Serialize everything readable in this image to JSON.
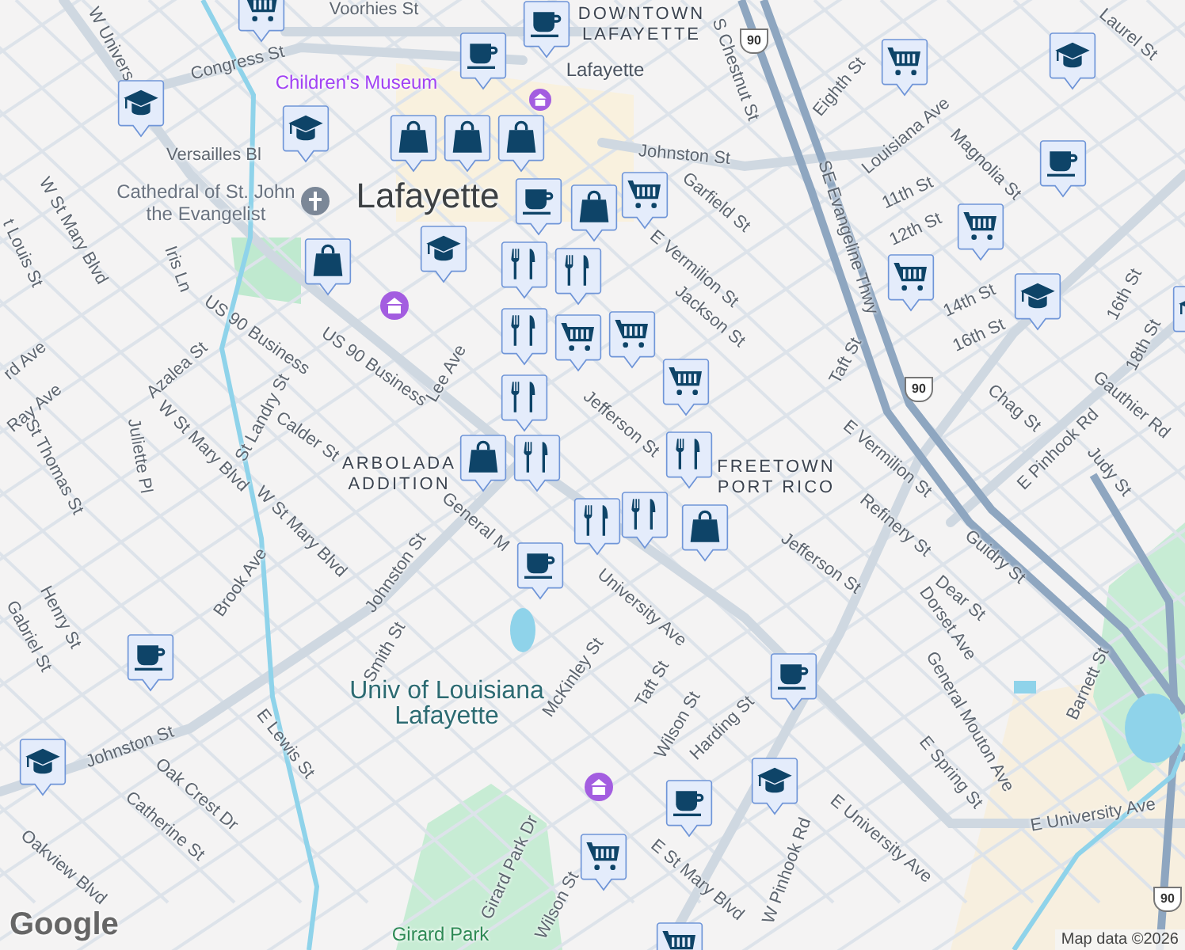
{
  "map": {
    "labels": [
      {
        "text": "Voorhies St",
        "kind": "street"
      },
      {
        "text": "W Univers",
        "kind": "street"
      },
      {
        "text": "Congress St",
        "kind": "street"
      },
      {
        "text": "Versailles Bl",
        "kind": "street"
      },
      {
        "text": "Cathedral of St. John the Evangelist",
        "kind": "poi"
      },
      {
        "text": "W St Mary Blvd",
        "kind": "street"
      },
      {
        "text": "t Louis St",
        "kind": "street"
      },
      {
        "text": "Iris Ln",
        "kind": "street"
      },
      {
        "text": "US 90 Business",
        "kind": "street"
      },
      {
        "text": "US 90 Business",
        "kind": "street"
      },
      {
        "text": "Azalea St",
        "kind": "street"
      },
      {
        "text": "St Landry St",
        "kind": "street"
      },
      {
        "text": "W St Mary Blvd",
        "kind": "street"
      },
      {
        "text": "rd Ave",
        "kind": "street"
      },
      {
        "text": "Ray Ave",
        "kind": "street"
      },
      {
        "text": "St Thomas St",
        "kind": "street"
      },
      {
        "text": "Juliette Pl",
        "kind": "street"
      },
      {
        "text": "Calder St",
        "kind": "street"
      },
      {
        "text": "Lee Ave",
        "kind": "street"
      },
      {
        "text": "Lafayette",
        "kind": "city"
      },
      {
        "text": "General M",
        "kind": "street"
      },
      {
        "text": "Jefferson St",
        "kind": "street"
      },
      {
        "text": "Jackson St",
        "kind": "street"
      },
      {
        "text": "E Vermilion St",
        "kind": "street"
      },
      {
        "text": "Garfield St",
        "kind": "street"
      },
      {
        "text": "Johnston St",
        "kind": "street"
      },
      {
        "text": "ARBOLADA ADDITION",
        "kind": "area"
      },
      {
        "text": "DOWNTOWN LAFAYETTE",
        "kind": "area"
      },
      {
        "text": "Lafayette",
        "kind": "station"
      },
      {
        "text": "Children's Museum",
        "kind": "museum"
      },
      {
        "text": "S Chestnut St",
        "kind": "street"
      },
      {
        "text": "Eighth St",
        "kind": "street"
      },
      {
        "text": "Louisiana Ave",
        "kind": "street"
      },
      {
        "text": "Magnolia St",
        "kind": "street"
      },
      {
        "text": "SE Evangeline Thwy",
        "kind": "street"
      },
      {
        "text": "11th St",
        "kind": "street"
      },
      {
        "text": "12th St",
        "kind": "street"
      },
      {
        "text": "14th St",
        "kind": "street"
      },
      {
        "text": "16th St",
        "kind": "street"
      },
      {
        "text": "16th St",
        "kind": "street"
      },
      {
        "text": "18th St",
        "kind": "street"
      },
      {
        "text": "Laurel St",
        "kind": "street"
      },
      {
        "text": "Taft St",
        "kind": "street"
      },
      {
        "text": "Chag St",
        "kind": "street"
      },
      {
        "text": "E Pinhook Rd",
        "kind": "street"
      },
      {
        "text": "Judy St",
        "kind": "street"
      },
      {
        "text": "Gauthier Rd",
        "kind": "street"
      },
      {
        "text": "E Vermilion St",
        "kind": "street"
      },
      {
        "text": "FREETOWN PORT RICO",
        "kind": "area"
      },
      {
        "text": "Refinery St",
        "kind": "street"
      },
      {
        "text": "Guidry St",
        "kind": "street"
      },
      {
        "text": "Dear St",
        "kind": "street"
      },
      {
        "text": "Jefferson St",
        "kind": "street"
      },
      {
        "text": "Dorset Ave",
        "kind": "street"
      },
      {
        "text": "General Mouton Ave",
        "kind": "street"
      },
      {
        "text": "Barnett St",
        "kind": "street"
      },
      {
        "text": "E Spring St",
        "kind": "street"
      },
      {
        "text": "E University Ave",
        "kind": "street"
      },
      {
        "text": "E University Ave",
        "kind": "street"
      },
      {
        "text": "University Ave",
        "kind": "street"
      },
      {
        "text": "McKinley St",
        "kind": "street"
      },
      {
        "text": "Taft St",
        "kind": "street"
      },
      {
        "text": "Wilson St",
        "kind": "street"
      },
      {
        "text": "Harding St",
        "kind": "street"
      },
      {
        "text": "W Pinhook Rd",
        "kind": "street"
      },
      {
        "text": "E St Mary Blvd",
        "kind": "street"
      },
      {
        "text": "Johnston St",
        "kind": "street"
      },
      {
        "text": "Brook Ave",
        "kind": "street"
      },
      {
        "text": "W St Mary Blvd",
        "kind": "street"
      },
      {
        "text": "Smith St",
        "kind": "street"
      },
      {
        "text": "Univ of Louisiana Lafayette",
        "kind": "campus"
      },
      {
        "text": "E Lewis St",
        "kind": "street"
      },
      {
        "text": "Johnston St",
        "kind": "street"
      },
      {
        "text": "Oak Crest Dr",
        "kind": "street"
      },
      {
        "text": "Catherine St",
        "kind": "street"
      },
      {
        "text": "Oakview Blvd",
        "kind": "street"
      },
      {
        "text": "Henry St",
        "kind": "street"
      },
      {
        "text": "Gabriel St",
        "kind": "street"
      },
      {
        "text": "Girard Park Dr",
        "kind": "street"
      },
      {
        "text": "Girard Park",
        "kind": "park"
      },
      {
        "text": "Wilson St",
        "kind": "street"
      }
    ],
    "shields": [
      "90",
      "90",
      "90"
    ],
    "pins": [
      {
        "kind": "cafe"
      },
      {
        "kind": "cart"
      },
      {
        "kind": "cafe"
      },
      {
        "kind": "school"
      },
      {
        "kind": "school"
      },
      {
        "kind": "bag"
      },
      {
        "kind": "bag"
      },
      {
        "kind": "bag"
      },
      {
        "kind": "cafe"
      },
      {
        "kind": "school"
      },
      {
        "kind": "cart"
      },
      {
        "kind": "bag"
      },
      {
        "kind": "bag"
      },
      {
        "kind": "cart"
      },
      {
        "kind": "school"
      },
      {
        "kind": "cafe"
      },
      {
        "kind": "cart"
      },
      {
        "kind": "cart"
      },
      {
        "kind": "school"
      },
      {
        "kind": "school"
      },
      {
        "kind": "food"
      },
      {
        "kind": "food"
      },
      {
        "kind": "food"
      },
      {
        "kind": "cart"
      },
      {
        "kind": "cart"
      },
      {
        "kind": "cart"
      },
      {
        "kind": "food"
      },
      {
        "kind": "bag"
      },
      {
        "kind": "food"
      },
      {
        "kind": "food"
      },
      {
        "kind": "food"
      },
      {
        "kind": "food"
      },
      {
        "kind": "bag"
      },
      {
        "kind": "cafe"
      },
      {
        "kind": "cafe"
      },
      {
        "kind": "cafe"
      },
      {
        "kind": "school"
      },
      {
        "kind": "school"
      },
      {
        "kind": "cafe"
      },
      {
        "kind": "cart"
      },
      {
        "kind": "cart"
      }
    ]
  },
  "attribution": {
    "logo": "Google",
    "text": "Map data ©2026"
  }
}
